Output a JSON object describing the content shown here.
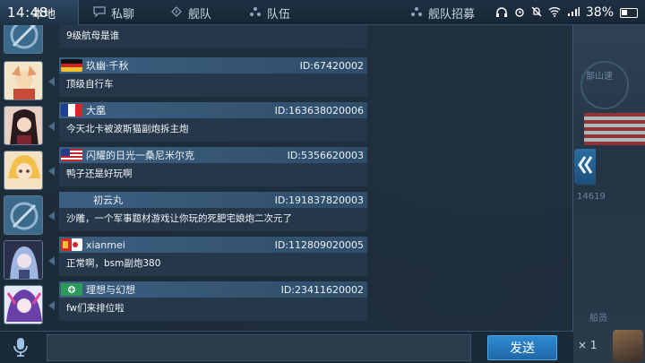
{
  "status_bar": {
    "time": "14:48",
    "battery_percent": "38%"
  },
  "tabs": [
    {
      "label": "本地",
      "icon": "globe-icon",
      "active": true
    },
    {
      "label": "私聊",
      "icon": "chat-icon",
      "active": false
    },
    {
      "label": "舰队",
      "icon": "fleet-icon",
      "active": false
    },
    {
      "label": "队伍",
      "icon": "team-icon",
      "active": false
    },
    {
      "label": "舰队招募",
      "icon": "recruit-icon",
      "active": false
    }
  ],
  "messages": [
    {
      "name": "",
      "uid": "",
      "text": "9级航母是谁",
      "flag": "none",
      "avatar_colors": [
        "#3c6a8a",
        "#93b6cf"
      ]
    },
    {
      "name": "玖幽·千秋",
      "uid": "ID:67420002",
      "text": "顶级自行车",
      "flag": "de",
      "avatar_colors": [
        "#f4e6c8",
        "#e49a6a"
      ]
    },
    {
      "name": "大凰",
      "uid": "ID:163638020006",
      "text": "今天北卡被波斯猫副炮拆主炮",
      "flag": "fr",
      "avatar_colors": [
        "#7c2430",
        "#e7d0c3"
      ]
    },
    {
      "name": "闪耀的日光一桑尼米尔克",
      "uid": "ID:5356620003",
      "text": "鸭子还是好玩啊",
      "flag": "us",
      "avatar_colors": [
        "#f2c04a",
        "#f3e1c2"
      ]
    },
    {
      "name": "初云丸",
      "uid": "ID:191837820003",
      "text": "沙雕，一个军事题材游戏让你玩的死肥宅娘炮二次元了",
      "flag": "none",
      "avatar_colors": [
        "#3c6a8a",
        "#93b6cf"
      ]
    },
    {
      "name": "xianmei",
      "uid": "ID:112809020005",
      "text": "正常啊，bsm副炮380",
      "flag": "mixed",
      "avatar_colors": [
        "#2a2f4a",
        "#9fb7e0"
      ]
    },
    {
      "name": "理想与幻想",
      "uid": "ID:23411620002",
      "text": "fw们来排位啦",
      "flag": "green",
      "avatar_colors": [
        "#6a3fa8",
        "#e6e9f7"
      ]
    }
  ],
  "input": {
    "placeholder": "",
    "send_label": "发送"
  },
  "background": {
    "right_label_1": "部山速",
    "right_label_2": "14619",
    "right_label_3": "船员",
    "bottom_counter": "× 1"
  },
  "colors": {
    "accent": "#2f8ad0",
    "header_bar": "#3d5f80",
    "panel": "#1e2c3a"
  }
}
